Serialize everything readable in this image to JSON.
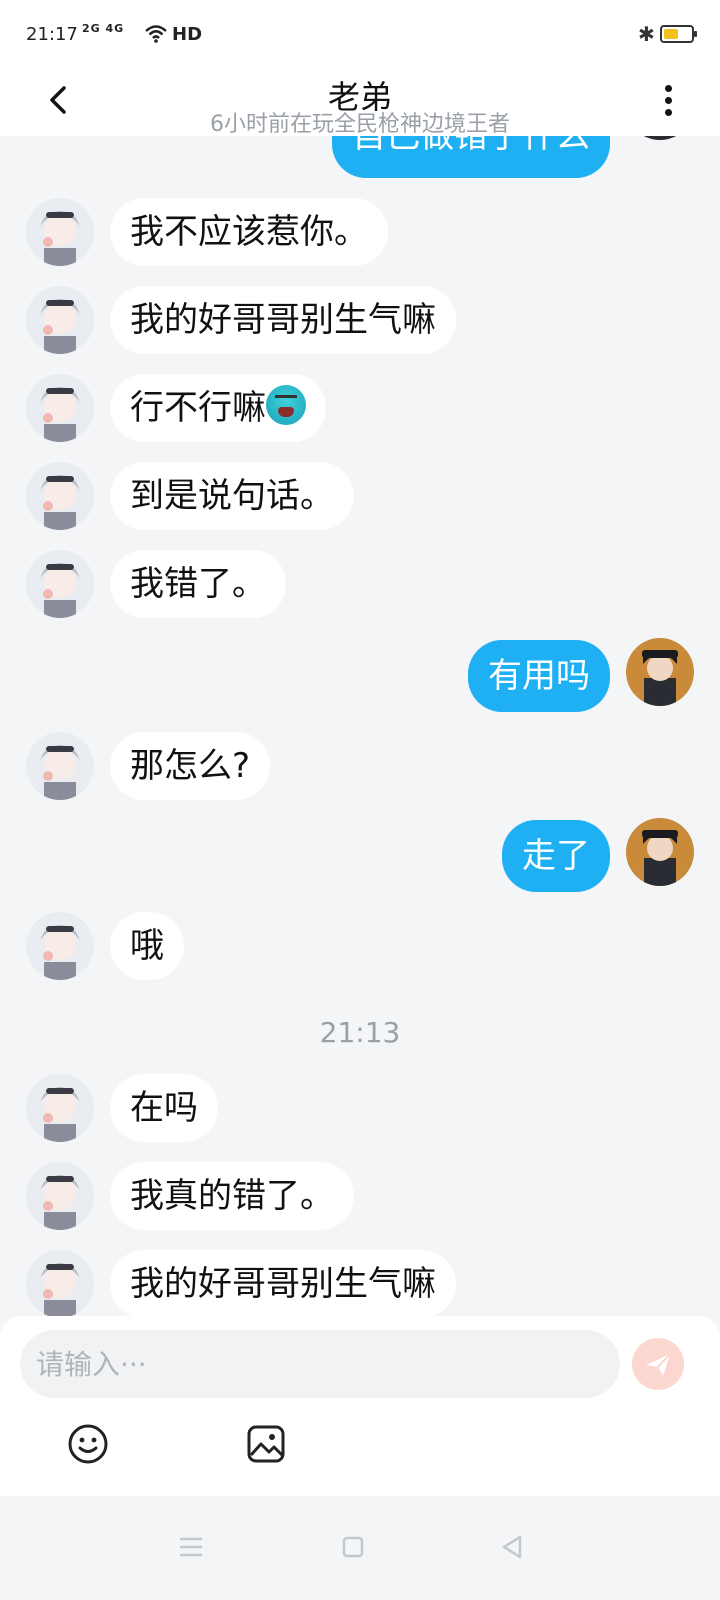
{
  "status_bar": {
    "time": "21:17",
    "network": "2G 4G",
    "hd": "HD",
    "battery_level": 0.55,
    "battery_color": "#f2c21b"
  },
  "header": {
    "title": "老弟",
    "subtitle": "6小时前在玩全民枪神边境王者"
  },
  "messages": {
    "partial_top": "自己做错了什么",
    "m1": "我不应该惹你。",
    "m2": "我的好哥哥别生气嘛",
    "m3": "行不行嘛",
    "m3_emoji": "tired-face-emoji",
    "m4": "到是说句话。",
    "m5": "我错了。",
    "m6": "有用吗",
    "m7": "那怎么?",
    "m8": "走了",
    "m9": "哦",
    "time_separator": "21:13",
    "m10": "在吗",
    "m11": "我真的错了。",
    "m12": "我的好哥哥别生气嘛"
  },
  "input": {
    "placeholder": "请输入···"
  },
  "colors": {
    "accent": "#1eb0f2",
    "send_inactive": "#fbd7cf",
    "background": "#f4f5f7"
  },
  "icons": {
    "back": "chevron-left-icon",
    "more": "more-vertical-icon",
    "send": "paper-plane-icon",
    "emoji": "smiley-icon",
    "image": "image-icon"
  }
}
